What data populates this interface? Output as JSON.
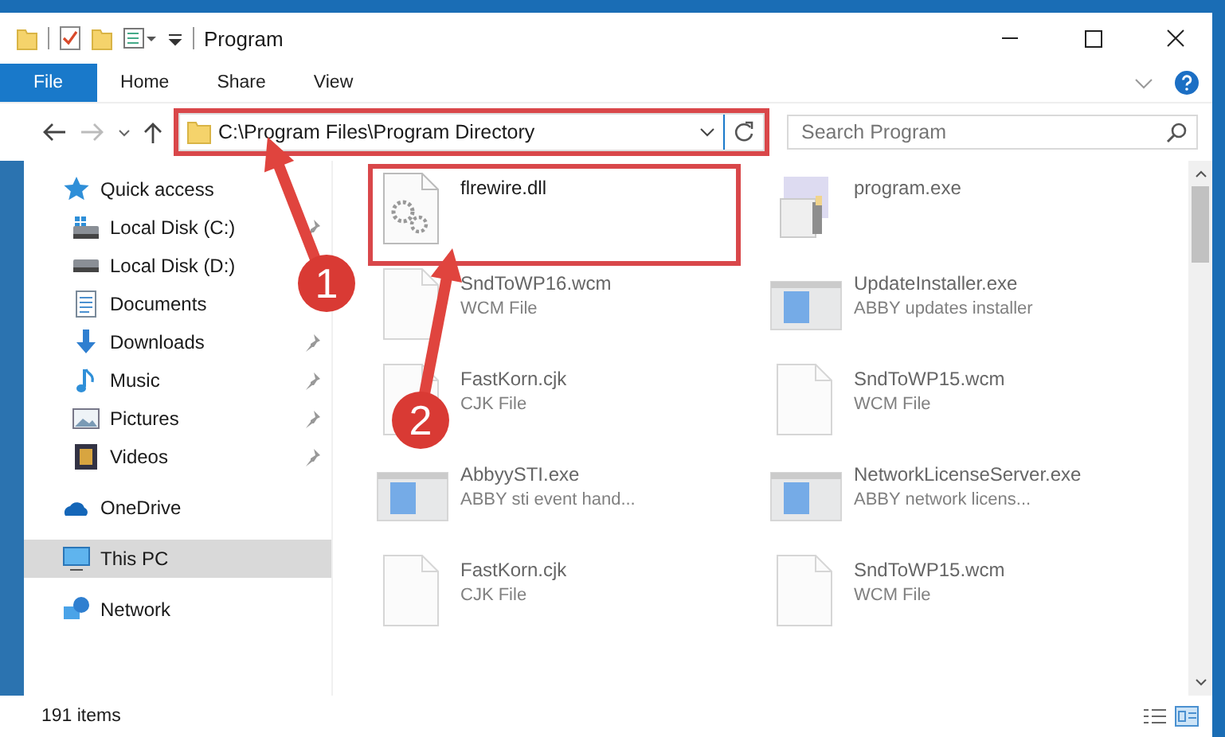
{
  "window": {
    "title": "Program"
  },
  "ribbon_tabs": [
    {
      "label": "File",
      "selected": true
    },
    {
      "label": "Home",
      "selected": false
    },
    {
      "label": "Share",
      "selected": false
    },
    {
      "label": "View",
      "selected": false
    }
  ],
  "address": {
    "path": "C:\\Program Files\\Program Directory",
    "highlighted": true
  },
  "search": {
    "placeholder": "Search Program"
  },
  "nav": [
    {
      "label": "Quick access",
      "kind": "star",
      "selected": false,
      "children": [
        {
          "label": "Local Disk (C:)",
          "kind": "disk-c",
          "pinned": true,
          "selected": false
        },
        {
          "label": "Local Disk (D:)",
          "kind": "disk",
          "pinned": false,
          "selected": false
        },
        {
          "label": "Documents",
          "kind": "docs",
          "pinned": false,
          "selected": false
        },
        {
          "label": "Downloads",
          "kind": "download",
          "pinned": true,
          "selected": false
        },
        {
          "label": "Music",
          "kind": "music",
          "pinned": true,
          "selected": false
        },
        {
          "label": "Pictures",
          "kind": "pictures",
          "pinned": true,
          "selected": false
        },
        {
          "label": "Videos",
          "kind": "videos",
          "pinned": true,
          "selected": false
        }
      ]
    },
    {
      "label": "OneDrive",
      "kind": "cloud",
      "selected": false
    },
    {
      "label": "This PC",
      "kind": "pc",
      "selected": true
    },
    {
      "label": "Network",
      "kind": "network",
      "selected": false
    }
  ],
  "files": [
    {
      "name": "flrewire.dll",
      "kind": "dll",
      "blurred": false,
      "highlighted": true
    },
    {
      "name": "program.exe",
      "kind": "setup",
      "blurred": true,
      "highlighted": false
    },
    {
      "name": "SndToWP16.wcm",
      "description": "WCM File",
      "kind": "doc",
      "blurred": true,
      "highlighted": false
    },
    {
      "name": "UpdateInstaller.exe",
      "description": "ABBY updates installer",
      "kind": "app",
      "blurred": true,
      "highlighted": false
    },
    {
      "name": "FastKorn.cjk",
      "description": "CJK File",
      "kind": "doc",
      "blurred": true,
      "highlighted": false
    },
    {
      "name": "SndToWP15.wcm",
      "description": "WCM File",
      "kind": "doc",
      "blurred": true,
      "highlighted": false
    },
    {
      "name": "AbbyySTI.exe",
      "description": "ABBY sti event hand...",
      "kind": "app",
      "blurred": true,
      "highlighted": false
    },
    {
      "name": "NetworkLicenseServer.exe",
      "description": "ABBY network licens...",
      "kind": "app",
      "blurred": true,
      "highlighted": false
    },
    {
      "name": "FastKorn.cjk",
      "description": "CJK File",
      "kind": "doc",
      "blurred": true,
      "highlighted": false
    },
    {
      "name": "SndToWP15.wcm",
      "description": "WCM File",
      "kind": "doc",
      "blurred": true,
      "highlighted": false
    }
  ],
  "status_bar": {
    "text": "191 items"
  },
  "annotations": [
    {
      "label": "1"
    },
    {
      "label": "2"
    }
  ]
}
